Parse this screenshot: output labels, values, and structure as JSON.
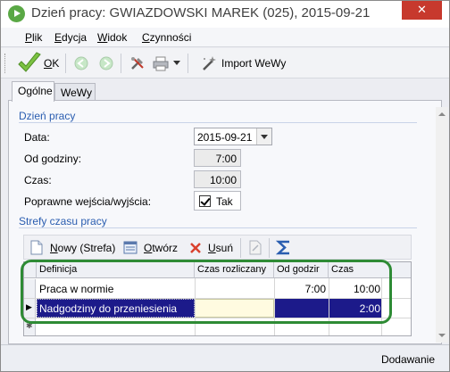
{
  "window": {
    "title": "Dzień pracy: GWIAZDOWSKI MAREK (025), 2015-09-21",
    "close_label": "✕"
  },
  "menu": {
    "items": [
      {
        "underline": "P",
        "rest": "lik"
      },
      {
        "underline": "E",
        "rest": "dycja"
      },
      {
        "underline": "W",
        "rest": "idok"
      },
      {
        "underline": "C",
        "rest": "zynności"
      }
    ]
  },
  "toolbar": {
    "ok_underline": "O",
    "ok_rest": "K",
    "import_label": "Import WeWy"
  },
  "tabs": [
    {
      "label": "Ogólne"
    },
    {
      "label": "WeWy"
    }
  ],
  "dzien_pracy": {
    "section_label": "Dzień pracy",
    "data_label": "Data:",
    "data_value": "2015-09-21",
    "od_godziny_label": "Od godziny:",
    "od_godziny_value": "7:00",
    "czas_label": "Czas:",
    "czas_value": "10:00",
    "poprawne_label": "Poprawne wejścia/wyjścia:",
    "poprawne_value": "Tak",
    "poprawne_checked": true
  },
  "strefy": {
    "section_label": "Strefy czasu pracy",
    "toolbar": {
      "nowy_underline": "N",
      "nowy_rest": "owy (Strefa)",
      "otworz_underline": "O",
      "otworz_rest": "twórz",
      "usun_underline": "U",
      "usun_rest": "suń"
    },
    "columns": [
      "Definicja",
      "Czas rozliczany",
      "Od godzir",
      "Czas"
    ],
    "rows": [
      {
        "definicja": "Praca w normie",
        "czas_rozliczany": "",
        "od_godziny": "7:00",
        "czas": "10:00",
        "selected": false
      },
      {
        "definicja": "Nadgodziny do przeniesienia",
        "czas_rozliczany": "",
        "od_godziny": "",
        "czas": "2:00",
        "selected": true
      }
    ],
    "new_row_marker": "✱",
    "current_row_marker": "▶"
  },
  "status": {
    "text": "Dodawanie"
  },
  "colors": {
    "accent_blue": "#2a5db0",
    "selection": "#1c1a8a",
    "highlight_ring": "#2e8b35",
    "close_red": "#c7392d"
  }
}
